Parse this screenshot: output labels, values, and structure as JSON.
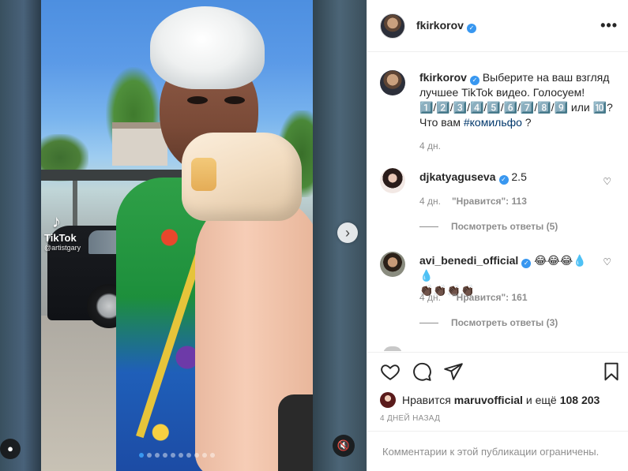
{
  "media": {
    "watermark_brand": "TikTok",
    "watermark_handle": "@artistgary",
    "next_icon": "chevron-right-icon",
    "carousel_total": 10,
    "carousel_active_index": 0
  },
  "post": {
    "username": "fkirkorov",
    "more_label": "•••",
    "caption_line1": "Выберите на ваш взгляд лучшее TikTok видео. Голосуем!",
    "caption_line2": "1️⃣/2️⃣/3️⃣/4️⃣/5️⃣/6️⃣/7️⃣/8️⃣/9️⃣ или 🔟?",
    "caption_line3_prefix": "Что вам ",
    "caption_hashtag": "#комильфо",
    "caption_line3_suffix": " ?",
    "caption_time": "4 дн."
  },
  "comments": [
    {
      "username": "djkatyaguseva",
      "verified": true,
      "text": "2.5",
      "time": "4 дн.",
      "likes": "\"Нравится\": 113",
      "replies": "Посмотреть ответы (5)"
    },
    {
      "username": "avi_benedi_official",
      "verified": true,
      "text": "😂😂😂💧💧",
      "text2": "👏🏿👏🏿👏🏿👏🏿",
      "time": "4 дн.",
      "likes": "\"Нравится\": 161",
      "replies": "Посмотреть ответы (3)"
    }
  ],
  "actions": {
    "liked_by_prefix": "Нравится",
    "liked_by_user": "maruvofficial",
    "liked_by_middle": "и ещё",
    "liked_by_count": "108 203",
    "date": "4 ДНЕЙ НАЗАД",
    "comments_restricted": "Комментарии к этой публикации ограничены."
  },
  "colors": {
    "link_blue": "#00376b",
    "verified_blue": "#3897f0",
    "muted_gray": "#8e8e8e",
    "text_dark": "#262626"
  }
}
